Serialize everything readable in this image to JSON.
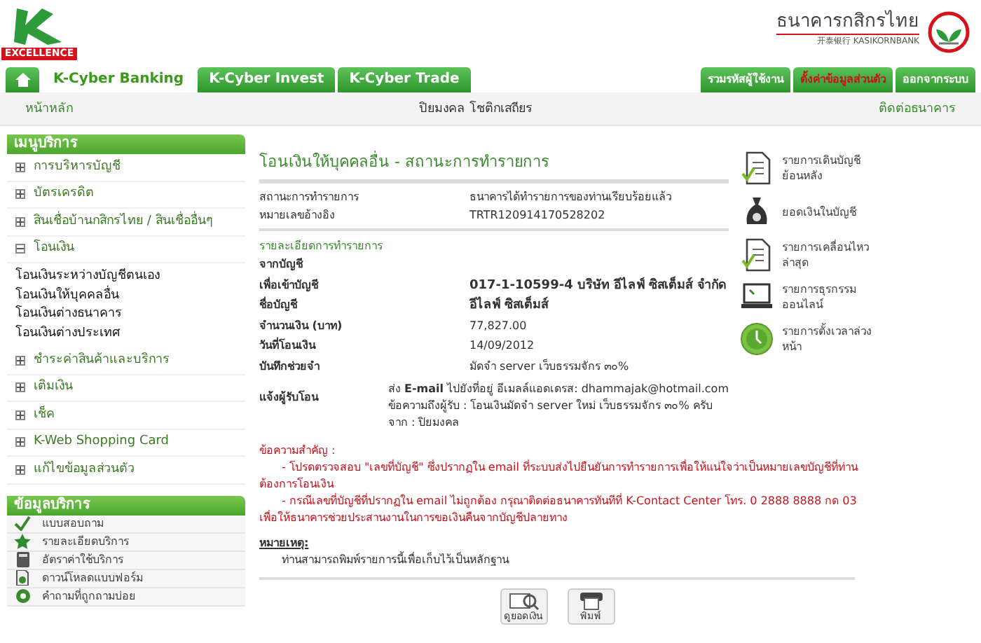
{
  "brand": {
    "logo_caption": "EXCELLENCE",
    "bank_name_th": "ธนาคารกสิกรไทย",
    "bank_name_en": "开泰银行 KASIKORNBANK"
  },
  "tabs": [
    {
      "kind": "home",
      "selected": false
    },
    {
      "kind": "text",
      "label": "K-Cyber Banking",
      "selected": true
    },
    {
      "kind": "text",
      "label": "K-Cyber Invest",
      "selected": false
    },
    {
      "kind": "text",
      "label": "K-Cyber Trade",
      "selected": false
    }
  ],
  "top_buttons": [
    {
      "label": "รวมรหัสผู้ใช้งาน",
      "alert": false
    },
    {
      "label": "ตั้งค่าข้อมูลส่วนตัว",
      "alert": true
    },
    {
      "label": "ออกจากระบบ",
      "alert": false
    }
  ],
  "breadcrumb": {
    "home": "หน้าหลัก",
    "user": "ปิยมงคล โชติกเสถียร",
    "contact": "ติดต่อธนาคาร"
  },
  "service_menu": {
    "title": "เมนูบริการ",
    "items": [
      {
        "label": "การบริหารบัญชี",
        "expanded": false
      },
      {
        "label": "บัตรเครดิต",
        "expanded": false
      },
      {
        "label": "สินเชื่อบ้านกสิกรไทย / สินเชื่ออื่นๆ",
        "expanded": false
      },
      {
        "label": "โอนเงิน",
        "expanded": true,
        "children": [
          "โอนเงินระหว่างบัญชีตนเอง",
          "โอนเงินให้บุคคลอื่น",
          "โอนเงินต่างธนาคาร",
          "โอนเงินต่างประเทศ"
        ]
      },
      {
        "label": "ชำระค่าสินค้าและบริการ",
        "expanded": false
      },
      {
        "label": "เติมเงิน",
        "expanded": false
      },
      {
        "label": "เช็ค",
        "expanded": false
      },
      {
        "label": "K-Web Shopping Card",
        "expanded": false
      },
      {
        "label": "แก้ไขข้อมูลส่วนตัว",
        "expanded": false
      }
    ]
  },
  "service_info": {
    "title": "ข้อมูลบริการ",
    "items": [
      {
        "kind": "check",
        "label": "แบบสอบถาม"
      },
      {
        "kind": "star",
        "label": "รายละเอียดบริการ"
      },
      {
        "kind": "calculator",
        "label": "อัตราค่าใช้บริการ"
      },
      {
        "kind": "download",
        "label": "ดาวน์โหลดแบบฟอร์ม"
      },
      {
        "kind": "question",
        "label": "คำถามที่ถูกถามบ่อย"
      }
    ]
  },
  "page_title": "โอนเงินให้บุคคลอื่น - สถานะการทำรายการ",
  "status_rows": [
    {
      "label": "สถานะการทำรายการ",
      "value": "ธนาคารได้ทำรายการของท่านเรียบร้อยแล้ว"
    },
    {
      "label": "หมายเลขอ้างอิง",
      "value": "TRTR120914170528202"
    }
  ],
  "details_title": "รายละเอียดการทำรายการ",
  "detail_rows": [
    {
      "label": "จากบัญชี"
    },
    {
      "label": "เพื่อเข้าบัญชี",
      "value": "017-1-10599-4 บริษัท อีไลฟ์ ซิสเต็มส์ จำกัด",
      "bold": true
    },
    {
      "label": "ชื่อบัญชี",
      "value": "อีไลฟ์ ซิสเต็มส์",
      "bold": true
    },
    {
      "label": "จำนวนเงิน (บาท)",
      "value": "77,827.00",
      "bold": false
    },
    {
      "label": "วันที่โอนเงิน",
      "value": "14/09/2012",
      "bold": false
    },
    {
      "label": "บันทึกช่วยจำ",
      "value": "มัดจำ server เว็บธรรมจักร ๓๐%",
      "bold": false
    }
  ],
  "notify": {
    "label": "แจ้งผู้รับโอน",
    "lines": [
      "ส่ง **E-mail** ไปยังที่อยู่ อีเมลล์แอดเดรส: dhammajak@hotmail.com",
      "ข้อความถึงผู้รับ : โอนเงินมัดจำ server ใหม่ เว็บธรรมจักร ๓๐% ครับ",
      "จาก : ปิยมงคล"
    ]
  },
  "important": {
    "title": "ข้อความสำคัญ :",
    "items": [
      "- โปรดตรวจสอบ \"เลขที่บัญชี\" ซึ่งปรากฏใน email ที่ระบบส่งไปยืนยันการทำรายการเพื่อให้แน่ใจว่าเป็นหมายเลขบัญชีที่ท่านต้องการโอนเงิน",
      "- กรณีเลขที่บัญชีที่ปรากฏใน email ไม่ถูกต้อง กรุณาติดต่อธนาคารทันทีที่ K-Contact Center โทร. 0 2888 8888 กด 03 เพื่อให้ธนาคารช่วยประสานงานในการขอเงินคืนจากบัญชีปลายทาง"
    ]
  },
  "remark": {
    "title": "หมายเหตุ:",
    "text": "ท่านสามารถพิมพ์รายการนี้เพื่อเก็บไว้เป็นหลักฐาน"
  },
  "actions": [
    {
      "kind": "balance",
      "label": "ดูยอดเงิน"
    },
    {
      "kind": "print",
      "label": "พิมพ์"
    }
  ],
  "quick_links": [
    {
      "kind": "statement",
      "label": "รายการเดินบัญชีย้อนหลัง"
    },
    {
      "kind": "moneybag",
      "label": "ยอดเงินในบัญชี"
    },
    {
      "kind": "statement",
      "label": "รายการเคลื่อนไหวล่าสุด"
    },
    {
      "kind": "laptop",
      "label": "รายการธุรกรรมออนไลน์"
    },
    {
      "kind": "clock",
      "label": "รายการตั้งเวลาล่วงหน้า"
    }
  ]
}
